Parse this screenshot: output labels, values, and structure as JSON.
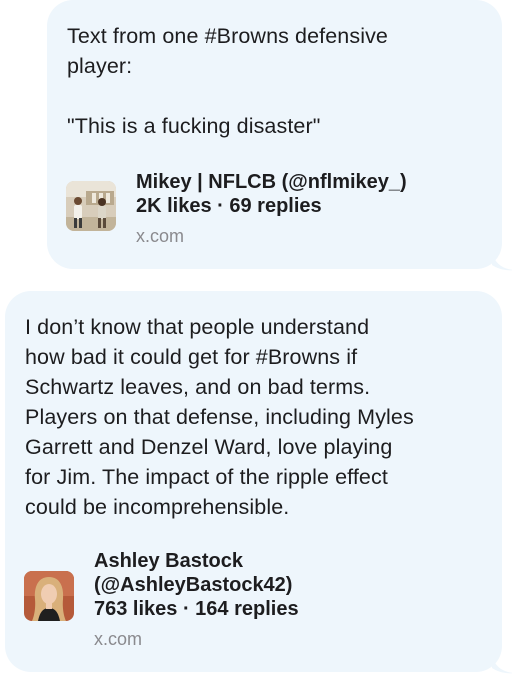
{
  "messages": [
    {
      "text": "Text from one #Browns defensive\nplayer:\n\n\"This is a fucking disaster\"",
      "preview": {
        "title": "Mikey | NFLCB (@nflmikey_)",
        "stats": "2K likes · 69 replies",
        "domain": "x.com",
        "thumb_icon": "photo-thumbnail-icon"
      }
    },
    {
      "text": "I don’t know that people understand\nhow bad it could get for #Browns if\nSchwartz leaves, and on bad terms.\nPlayers on that defense, including Myles\nGarrett and Denzel Ward, love playing\nfor Jim. The impact of the ripple effect\ncould be incomprehensible.",
      "preview": {
        "title": "Ashley Bastock\n(@AshleyBastock42)",
        "stats": "763 likes · 164 replies",
        "domain": "x.com",
        "thumb_icon": "profile-photo-icon"
      }
    }
  ],
  "colors": {
    "bubble": "#eef6fc",
    "text": "#1d1d1f",
    "domain": "#8a8a8e"
  }
}
